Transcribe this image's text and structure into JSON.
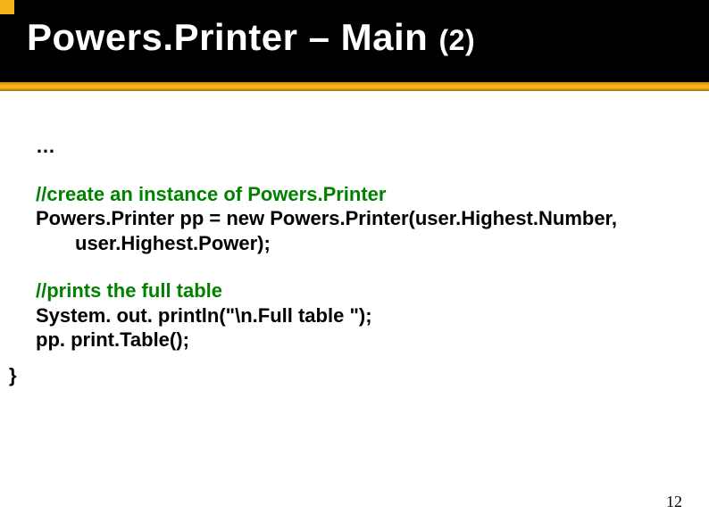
{
  "title": {
    "main": "Powers.Printer – Main ",
    "sub": "(2)"
  },
  "code": {
    "ellipsis": "…",
    "block1_comment": "//create an instance of Powers.Printer",
    "block1_line1": "Powers.Printer pp = new Powers.Printer(user.Highest.Number,",
    "block1_line2": "user.Highest.Power);",
    "block2_comment": "//prints the full table",
    "block2_line1": "System. out. println(\"\\n.Full table \");",
    "block2_line2": "pp. print.Table();",
    "close": "}"
  },
  "page_number": "12"
}
